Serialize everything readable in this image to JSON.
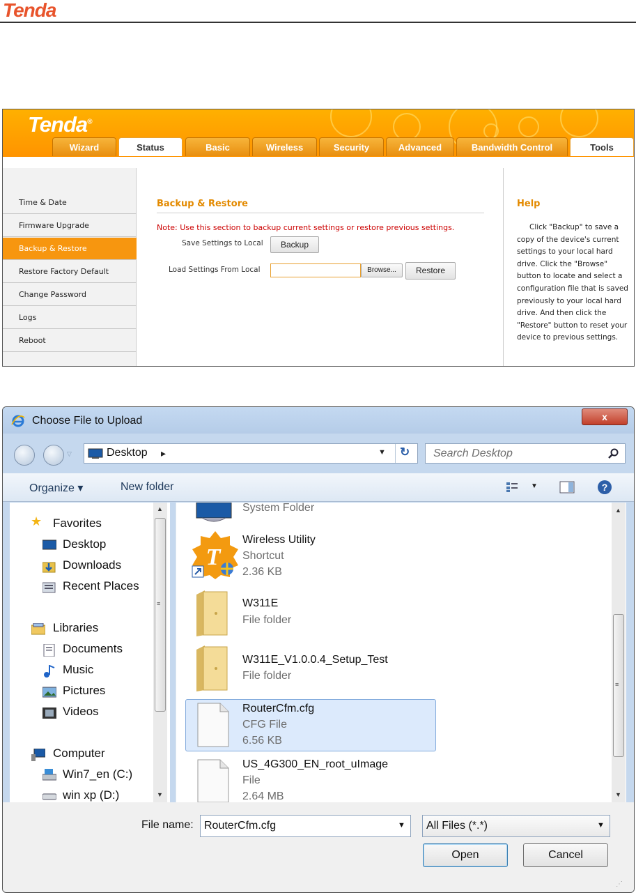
{
  "doc": {
    "logo": "Tenda"
  },
  "router": {
    "logo": "Tenda",
    "logo_mark": "®",
    "tabs": [
      "Wizard",
      "Status",
      "Basic",
      "Wireless",
      "Security",
      "Advanced",
      "Bandwidth Control",
      "Tools"
    ],
    "sidebar": [
      "Time & Date",
      "Firmware Upgrade",
      "Backup & Restore",
      "Restore Factory Default",
      "Change Password",
      "Logs",
      "Reboot"
    ],
    "section_title": "Backup & Restore",
    "note": "Note: Use this section to backup current settings or restore previous settings.",
    "save_label": "Save Settings to Local",
    "backup_button": "Backup",
    "load_label": "Load Settings From Local",
    "browse_button": "Browse...",
    "restore_button": "Restore",
    "help_title": "Help",
    "help_text": "Click \"Backup\" to save a copy of the device's current settings to your local hard drive. Click the \"Browse\" button to locate and select a configuration file that is saved previously to your local hard drive. And then click the \"Restore\" button to reset your device to previous settings."
  },
  "dialog": {
    "title": "Choose File to Upload",
    "close": "x",
    "address": "Desktop",
    "address_arrow": "▸",
    "search_placeholder": "Search Desktop",
    "toolbar": {
      "organize": "Organize ▾",
      "new_folder": "New folder"
    },
    "nav": {
      "favorites": "Favorites",
      "desktop": "Desktop",
      "downloads": "Downloads",
      "recent": "Recent Places",
      "libraries": "Libraries",
      "documents": "Documents",
      "music": "Music",
      "pictures": "Pictures",
      "videos": "Videos",
      "computer": "Computer",
      "drive_c": "Win7_en (C:)",
      "drive_d": "win xp (D:)"
    },
    "files": [
      {
        "name": "",
        "type": "System Folder",
        "size": ""
      },
      {
        "name": "Wireless Utility",
        "type": "Shortcut",
        "size": "2.36 KB"
      },
      {
        "name": "W311E",
        "type": "File folder",
        "size": ""
      },
      {
        "name": "W311E_V1.0.0.4_Setup_Test",
        "type": "File folder",
        "size": ""
      },
      {
        "name": "RouterCfm.cfg",
        "type": "CFG File",
        "size": "6.56 KB"
      },
      {
        "name": "US_4G300_EN_root_uImage",
        "type": "File",
        "size": "2.64 MB"
      }
    ],
    "filename_label": "File name:",
    "filename_value": "RouterCfm.cfg",
    "filter_value": "All Files (*.*)",
    "open_button": "Open",
    "cancel_button": "Cancel"
  },
  "colors": {
    "brand_orange": "#f7960f",
    "note_red": "#cc0000",
    "selection": "#dceafc"
  }
}
